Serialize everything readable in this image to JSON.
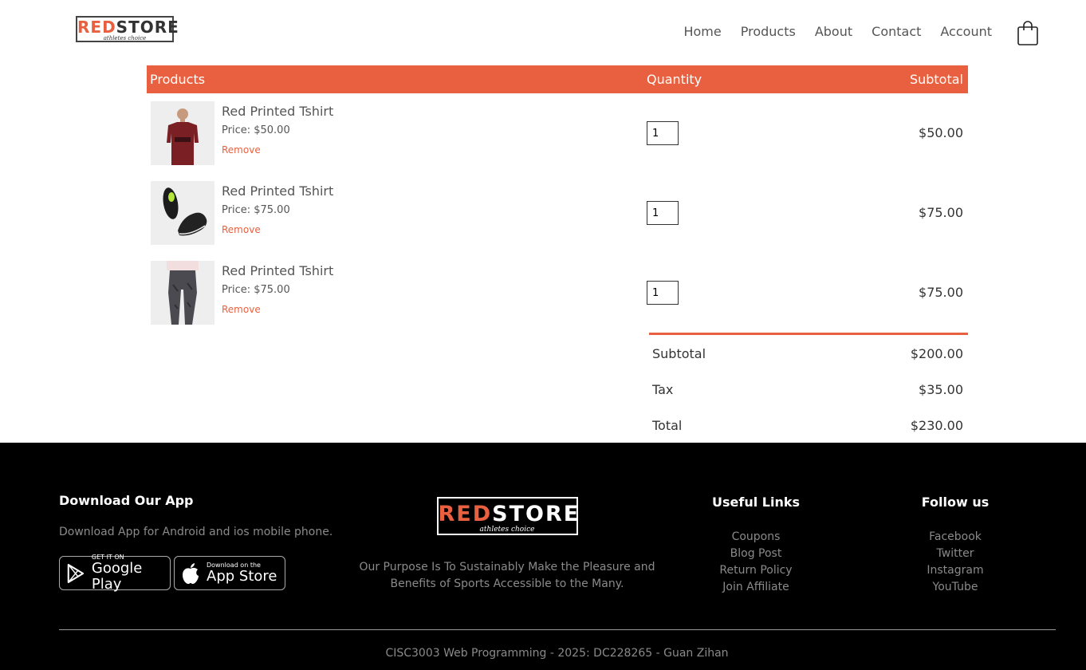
{
  "header": {
    "logo": {
      "red_part": "RED",
      "dark_part": "STORE",
      "tagline": "athletes choice"
    },
    "nav": [
      "Home",
      "Products",
      "About",
      "Contact",
      "Account"
    ]
  },
  "cart": {
    "headers": {
      "products": "Products",
      "quantity": "Quantity",
      "subtotal": "Subtotal"
    },
    "items": [
      {
        "name": "Red Printed Tshirt",
        "price": "Price: $50.00",
        "remove": "Remove",
        "qty": "1",
        "subtotal": "$50.00",
        "image": "red-tshirt-image"
      },
      {
        "name": "Red Printed Tshirt",
        "price": "Price: $75.00",
        "remove": "Remove",
        "qty": "1",
        "subtotal": "$75.00",
        "image": "black-shoes-image"
      },
      {
        "name": "Red Printed Tshirt",
        "price": "Price: $75.00",
        "remove": "Remove",
        "qty": "1",
        "subtotal": "$75.00",
        "image": "grey-joggers-image"
      }
    ],
    "totals": [
      {
        "label": "Subtotal",
        "value": "$200.00"
      },
      {
        "label": "Tax",
        "value": "$35.00"
      },
      {
        "label": "Total",
        "value": "$230.00"
      }
    ]
  },
  "footer": {
    "app": {
      "title": "Download Our App",
      "text": "Download App for Android and ios mobile phone.",
      "google": {
        "small": "GET IT ON",
        "large": "Google Play"
      },
      "apple": {
        "small": "Download on the",
        "large": "App Store"
      }
    },
    "brand": {
      "logo": {
        "red_part": "RED",
        "white_part": "STORE",
        "tagline": "athletes choice"
      },
      "text": "Our Purpose Is To Sustainably Make the Pleasure and Benefits of Sports Accessible to the Many."
    },
    "useful": {
      "title": "Useful Links",
      "links": [
        "Coupons",
        "Blog Post",
        "Return Policy",
        "Join Affiliate"
      ]
    },
    "follow": {
      "title": "Follow us",
      "links": [
        "Facebook",
        "Twitter",
        "Instagram",
        "YouTube"
      ]
    },
    "copyright": "CISC3003 Web Programming - 2025: DC228265 - Guan Zihan"
  },
  "colors": {
    "accent": "#e8603f",
    "footer_bg": "#000000"
  }
}
